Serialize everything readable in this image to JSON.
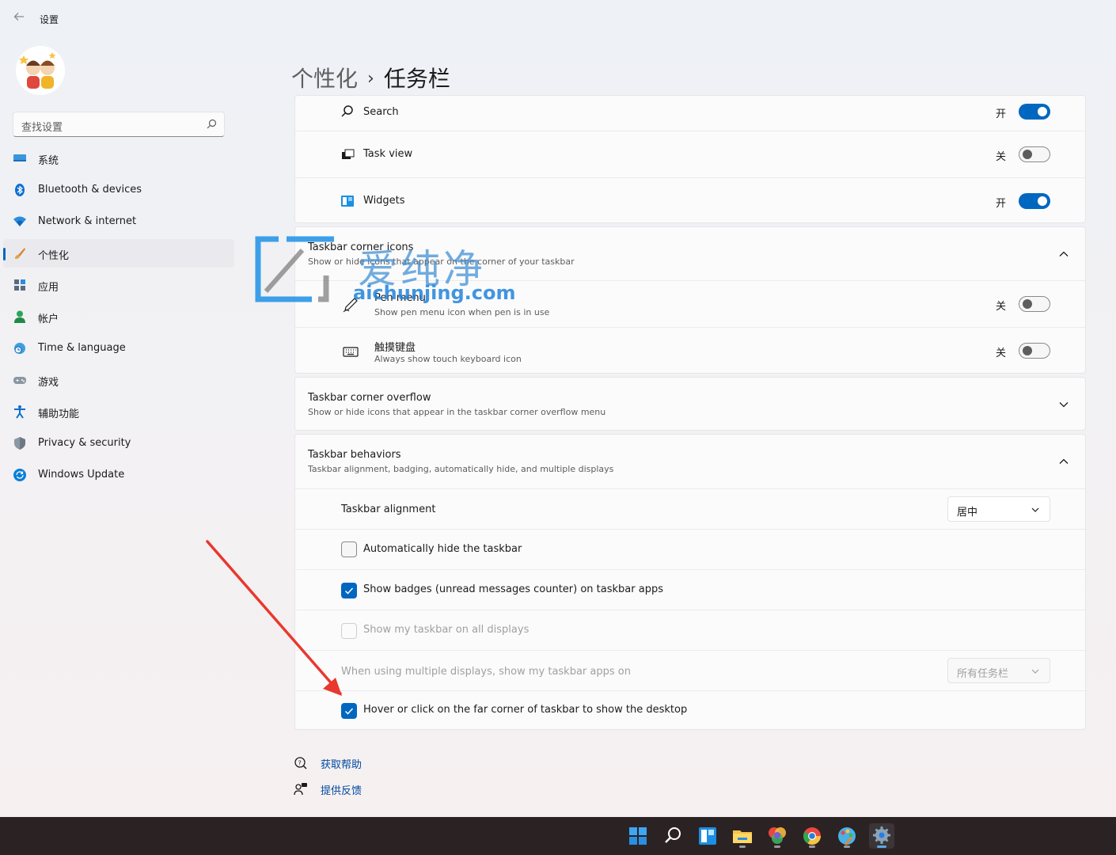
{
  "window": {
    "title": "设置",
    "back_icon": "back-arrow-icon"
  },
  "sidebar": {
    "search_placeholder": "查找设置",
    "items": [
      {
        "label": "系统",
        "icon": "system-icon"
      },
      {
        "label": "Bluetooth & devices",
        "icon": "bluetooth-icon"
      },
      {
        "label": "Network & internet",
        "icon": "wifi-icon"
      },
      {
        "label": "个性化",
        "icon": "brush-icon",
        "active": true
      },
      {
        "label": "应用",
        "icon": "apps-icon"
      },
      {
        "label": "帐户",
        "icon": "account-icon"
      },
      {
        "label": "Time & language",
        "icon": "globe-clock-icon"
      },
      {
        "label": "游戏",
        "icon": "gamepad-icon"
      },
      {
        "label": "辅助功能",
        "icon": "accessibility-icon"
      },
      {
        "label": "Privacy & security",
        "icon": "shield-icon"
      },
      {
        "label": "Windows Update",
        "icon": "update-icon"
      }
    ]
  },
  "header": {
    "crumb": "个性化",
    "separator": "›",
    "title": "任务栏"
  },
  "taskbar_items": {
    "search": {
      "label": "Search",
      "state": "开",
      "on": true
    },
    "task_view": {
      "label": "Task view",
      "state": "关",
      "on": false
    },
    "widgets": {
      "label": "Widgets",
      "state": "开",
      "on": true
    }
  },
  "corner_icons": {
    "title": "Taskbar corner icons",
    "subtitle": "Show or hide icons that appear on the corner of your taskbar",
    "pen": {
      "title": "Pen menu",
      "subtitle": "Show pen menu icon when pen is in use",
      "state": "关",
      "on": false
    },
    "keyboard": {
      "title": "触摸键盘",
      "subtitle": "Always show touch keyboard icon",
      "state": "关",
      "on": false
    }
  },
  "corner_overflow": {
    "title": "Taskbar corner overflow",
    "subtitle": "Show or hide icons that appear in the taskbar corner overflow menu"
  },
  "behaviors": {
    "title": "Taskbar behaviors",
    "subtitle": "Taskbar alignment, badging, automatically hide, and multiple displays",
    "alignment": {
      "label": "Taskbar alignment",
      "value": "居中"
    },
    "auto_hide": {
      "label": "Automatically hide the taskbar",
      "checked": false
    },
    "badges": {
      "label": "Show badges (unread messages counter) on taskbar apps",
      "checked": true
    },
    "all_displays": {
      "label": "Show my taskbar on all displays",
      "checked": false,
      "disabled": true
    },
    "multi_display": {
      "label": "When using multiple displays, show my taskbar apps on",
      "value": "所有任务栏",
      "disabled": true
    },
    "far_corner": {
      "label": "Hover or click on the far corner of taskbar to show the desktop",
      "checked": true
    }
  },
  "links": {
    "help": "获取帮助",
    "feedback": "提供反馈"
  },
  "watermark": {
    "text": "爱纯净",
    "url": "aichunjing.com"
  },
  "accent_color": "#0067c0",
  "annotation_color": "#e8382f",
  "windows_taskbar": {
    "icons": [
      "start-icon",
      "search-icon",
      "widgets-icon",
      "file-explorer-icon",
      "picture-app-icon",
      "chrome-icon",
      "paint-icon",
      "settings-icon"
    ]
  }
}
